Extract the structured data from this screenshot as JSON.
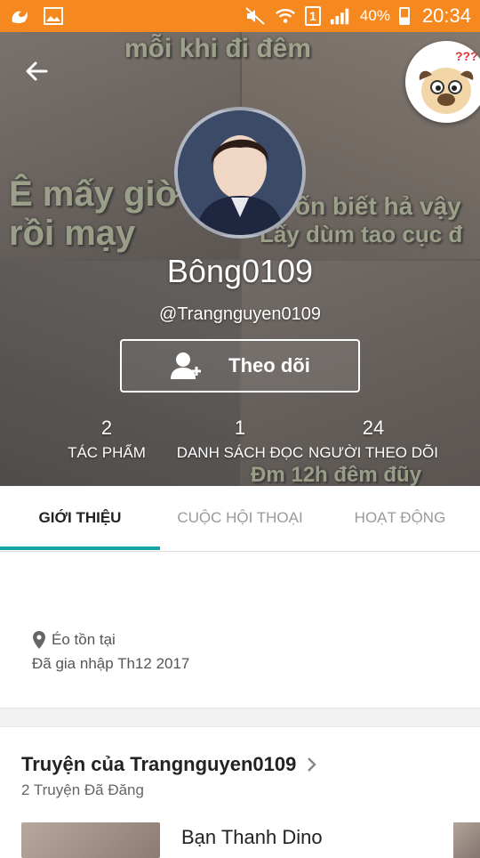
{
  "status_bar": {
    "battery_percent": "40%",
    "time": "20:34",
    "sim_label": "1",
    "color": "#f5891f",
    "icons": [
      "uc-browser-icon",
      "gallery-icon",
      "mute-icon",
      "wifi-icon",
      "sim-icon",
      "signal-icon",
      "battery-icon"
    ]
  },
  "header": {
    "meme_texts": [
      "mỗi khi đi đêm",
      "Ê mấy giờ",
      "rồi mạy",
      "ốn biết hả vậy",
      "Lấy dùm tao cục đ",
      "Đm 12h đêm đũy"
    ],
    "display_name": "Bông0109",
    "username": "@Trangnguyen0109",
    "follow_label": "Theo dõi",
    "stats": [
      {
        "value": "2",
        "label": "TÁC PHẨM"
      },
      {
        "value": "1",
        "label": "DANH SÁCH ĐỌC"
      },
      {
        "value": "24",
        "label": "NGƯỜI THEO DÕI"
      }
    ]
  },
  "tabs": [
    {
      "label": "GIỚI THIỆU",
      "active": true
    },
    {
      "label": "CUỘC HỘI THOẠI",
      "active": false
    },
    {
      "label": "HOẠT ĐỘNG",
      "active": false
    }
  ],
  "about": {
    "location": "Éo tồn tại",
    "joined": "Đã gia nhập Th12 2017"
  },
  "stories": {
    "title": "Truyện của Trangnguyen0109",
    "count_label": "2 Truyện Đã Đăng",
    "items": [
      {
        "title": "Bạn Thanh Dino"
      }
    ]
  },
  "colors": {
    "accent": "#12a5a4",
    "online_dot": "#3ecf3e"
  }
}
